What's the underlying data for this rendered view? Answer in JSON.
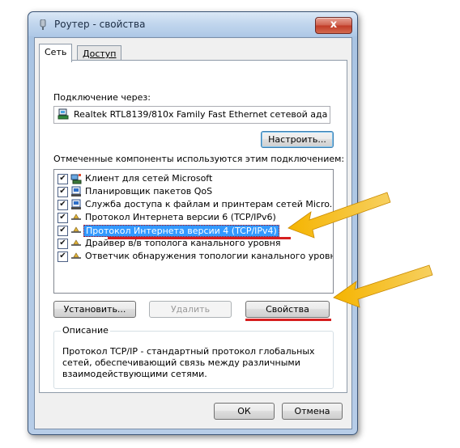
{
  "window": {
    "title": "Роутер - свойства",
    "close_glyph": "x"
  },
  "tabs": [
    {
      "label": "Сеть",
      "active": true
    },
    {
      "label": "Доступ",
      "active": false
    }
  ],
  "connection": {
    "label": "Подключение через:",
    "adapter_name": "Realtek RTL8139/810x Family Fast Ethernet сетевой ада",
    "configure_button": "Настроить..."
  },
  "components": {
    "label": "Отмеченные компоненты используются этим подключением:",
    "items": [
      {
        "label": "Клиент для сетей Microsoft",
        "checked": true,
        "icon": "network-client-icon"
      },
      {
        "label": "Планировщик пакетов QoS",
        "checked": true,
        "icon": "service-icon"
      },
      {
        "label": "Служба доступа к файлам и принтерам сетей Micro...",
        "checked": true,
        "icon": "service-icon"
      },
      {
        "label": "Протокол Интернета версии 6 (TCP/IPv6)",
        "checked": true,
        "icon": "protocol-icon"
      },
      {
        "label": "Протокол Интернета версии 4 (TCP/IPv4)",
        "checked": true,
        "icon": "protocol-icon",
        "selected": true
      },
      {
        "label": "Драйвер в/в тополога канального уровня",
        "checked": true,
        "icon": "protocol-icon"
      },
      {
        "label": "Ответчик обнаружения топологии канального уровня",
        "checked": true,
        "icon": "protocol-icon"
      }
    ]
  },
  "actions": {
    "install": "Установить...",
    "remove": "Удалить",
    "properties": "Свойства"
  },
  "description": {
    "title": "Описание",
    "text": "Протокол TCP/IP - стандартный протокол глобальных сетей, обеспечивающий связь между различными взаимодействующими сетями."
  },
  "footer": {
    "ok": "ОК",
    "cancel": "Отмена"
  },
  "colors": {
    "selection": "#3399ff",
    "highlight_underline": "#d61f1f",
    "arrow": "#f5b400"
  }
}
